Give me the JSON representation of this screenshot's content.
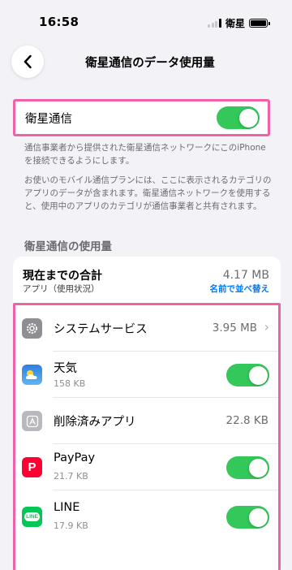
{
  "status_bar": {
    "time": "16:58",
    "carrier": "衛星"
  },
  "nav": {
    "title": "衛星通信のデータ使用量"
  },
  "satellite": {
    "label": "衛星通信",
    "enabled": true
  },
  "descriptions": [
    "通信事業者から提供された衛星通信ネットワークにこのiPhoneを接続できるようにします。",
    "お使いのモバイル通信プランには、ここに表示されるカテゴリのアプリのデータが含まれます。衛星通信ネットワークを使用すると、使用中のアプリのカテゴリが通信事業者と共有されます。"
  ],
  "usage": {
    "section_title": "衛星通信の使用量",
    "total_label": "現在までの合計",
    "total_value": "4.17 MB",
    "apps_label": "アプリ（使用状況）",
    "sort_label": "名前で並べ替え",
    "apps": [
      {
        "name": "システムサービス",
        "value": "3.95 MB",
        "icon": "gear-icon"
      },
      {
        "name": "天気",
        "size": "158 KB",
        "enabled": true,
        "icon": "weather-icon"
      },
      {
        "name": "削除済みアプリ",
        "value": "22.8 KB",
        "icon": "app-store-icon"
      },
      {
        "name": "PayPay",
        "size": "21.7 KB",
        "enabled": true,
        "icon": "paypay-icon",
        "icon_text": "P"
      },
      {
        "name": "LINE",
        "size": "17.9 KB",
        "enabled": true,
        "icon": "line-icon",
        "icon_text": "LINE"
      }
    ]
  },
  "colors": {
    "toggle_on": "#34c759",
    "highlight": "#f062a7",
    "link": "#007aff"
  }
}
